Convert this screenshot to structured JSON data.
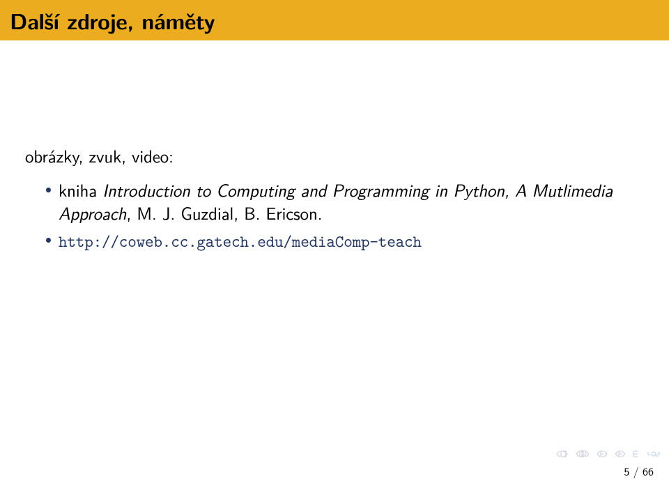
{
  "header": {
    "title": "Další zdroje, náměty"
  },
  "intro": "obrázky, zvuk, video:",
  "items": [
    {
      "book_prefix": "kniha ",
      "book_title": "Introduction to Computing and Programming in Python, A Mutlimedia Approach",
      "book_suffix": ", M. J. Guzdial, B. Ericson."
    },
    {
      "link": "http://coweb.cc.gatech.edu/mediaComp-teach"
    }
  ],
  "page": {
    "current": 5,
    "total": 66,
    "sep": " / "
  }
}
